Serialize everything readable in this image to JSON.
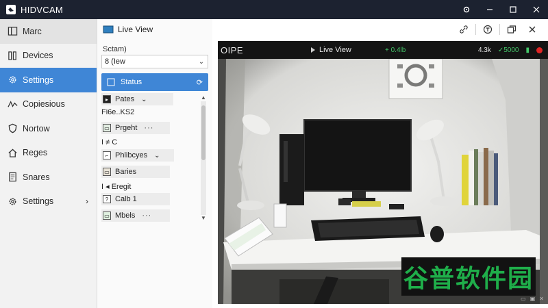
{
  "app": {
    "title": "HIDVCAM"
  },
  "nav": {
    "items": [
      {
        "label": "Marc",
        "icon": "layout-icon",
        "chev": ""
      },
      {
        "label": "Devices",
        "icon": "devices-icon",
        "chev": ""
      },
      {
        "label": "Settings",
        "icon": "gear-icon",
        "chev": ""
      },
      {
        "label": "Copiesious",
        "icon": "activity-icon",
        "chev": ""
      },
      {
        "label": "Nortow",
        "icon": "shield-icon",
        "chev": ""
      },
      {
        "label": "Reges",
        "icon": "home-icon",
        "chev": ""
      },
      {
        "label": "Snares",
        "icon": "document-icon",
        "chev": ""
      },
      {
        "label": "Settings",
        "icon": "gear-icon",
        "chev": "›"
      }
    ]
  },
  "mid": {
    "title": "Live View",
    "section_label": "Sctam)",
    "select_value": "8 (Iew",
    "status_label": "Status",
    "list": [
      {
        "label": "Pates",
        "type": "dropdown"
      },
      {
        "label": "Fi6e..KS2",
        "type": "text"
      },
      {
        "label": "Prgeht",
        "type": "card"
      },
      {
        "label": "I ≠ C",
        "type": "text"
      },
      {
        "label": "Phlibcyes",
        "type": "dropdown"
      },
      {
        "label": "Baries",
        "type": "card"
      },
      {
        "label": "I ◂ Eregit",
        "type": "text"
      },
      {
        "label": "Calb 1",
        "type": "card"
      },
      {
        "label": "Mbels",
        "type": "card"
      }
    ]
  },
  "camera": {
    "id": "OIPE",
    "live_label": "Live View",
    "bitrate": "+ 0.4lb",
    "stat1": "4.3k",
    "stat2": "5000",
    "status_colors": {
      "green": "#45c86a",
      "red": "#e02525"
    }
  },
  "watermark": {
    "text": "谷普软件园"
  },
  "colors": {
    "accent": "#3f86d6",
    "titlebar": "#1c2230"
  }
}
